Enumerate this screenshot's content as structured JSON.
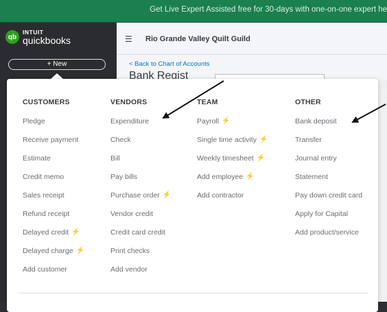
{
  "promo": {
    "text": "Get Live Expert Assisted free for 30-days with one-on-one expert he"
  },
  "brand": {
    "badge": "qb",
    "intuit": "INTUIT",
    "product": "quickbooks"
  },
  "nav": {
    "new_label": "+ New"
  },
  "header": {
    "company": "Rio Grande Valley Quilt Guild"
  },
  "register": {
    "back_link": "< Back to Chart of Accounts",
    "title_partial": "Bank Regist"
  },
  "menu": {
    "columns": [
      {
        "heading": "CUSTOMERS",
        "items": [
          {
            "label": "Pledge",
            "bolt": false
          },
          {
            "label": "Receive payment",
            "bolt": false
          },
          {
            "label": "Estimate",
            "bolt": false
          },
          {
            "label": "Credit memo",
            "bolt": false
          },
          {
            "label": "Sales receipt",
            "bolt": false
          },
          {
            "label": "Refund receipt",
            "bolt": false
          },
          {
            "label": "Delayed credit",
            "bolt": true
          },
          {
            "label": "Delayed charge",
            "bolt": true
          },
          {
            "label": "Add customer",
            "bolt": false
          }
        ]
      },
      {
        "heading": "VENDORS",
        "items": [
          {
            "label": "Expenditure",
            "bolt": false
          },
          {
            "label": "Check",
            "bolt": false
          },
          {
            "label": "Bill",
            "bolt": false
          },
          {
            "label": "Pay bills",
            "bolt": false
          },
          {
            "label": "Purchase order",
            "bolt": true
          },
          {
            "label": "Vendor credit",
            "bolt": false
          },
          {
            "label": "Credit card credit",
            "bolt": false
          },
          {
            "label": "Print checks",
            "bolt": false
          },
          {
            "label": "Add vendor",
            "bolt": false
          }
        ]
      },
      {
        "heading": "TEAM",
        "items": [
          {
            "label": "Payroll",
            "bolt": true
          },
          {
            "label": "Single time activity",
            "bolt": true
          },
          {
            "label": "Weekly timesheet",
            "bolt": true
          },
          {
            "label": "Add employee",
            "bolt": true
          },
          {
            "label": "Add contractor",
            "bolt": false
          }
        ]
      },
      {
        "heading": "OTHER",
        "items": [
          {
            "label": "Bank deposit",
            "bolt": false
          },
          {
            "label": "Transfer",
            "bolt": false
          },
          {
            "label": "Journal entry",
            "bolt": false
          },
          {
            "label": "Statement",
            "bolt": false
          },
          {
            "label": "Pay down credit card",
            "bolt": false
          },
          {
            "label": "Apply for Capital",
            "bolt": false
          },
          {
            "label": "Add product/service",
            "bolt": false
          }
        ]
      }
    ],
    "bolt_icon": "lightning-bolt-icon"
  },
  "colors": {
    "promo_bg": "#1b7f4e",
    "nav_bg": "#2b2c30",
    "menu_heading": "#393a3d",
    "menu_item": "#6b6c72",
    "link": "#0077c5"
  }
}
